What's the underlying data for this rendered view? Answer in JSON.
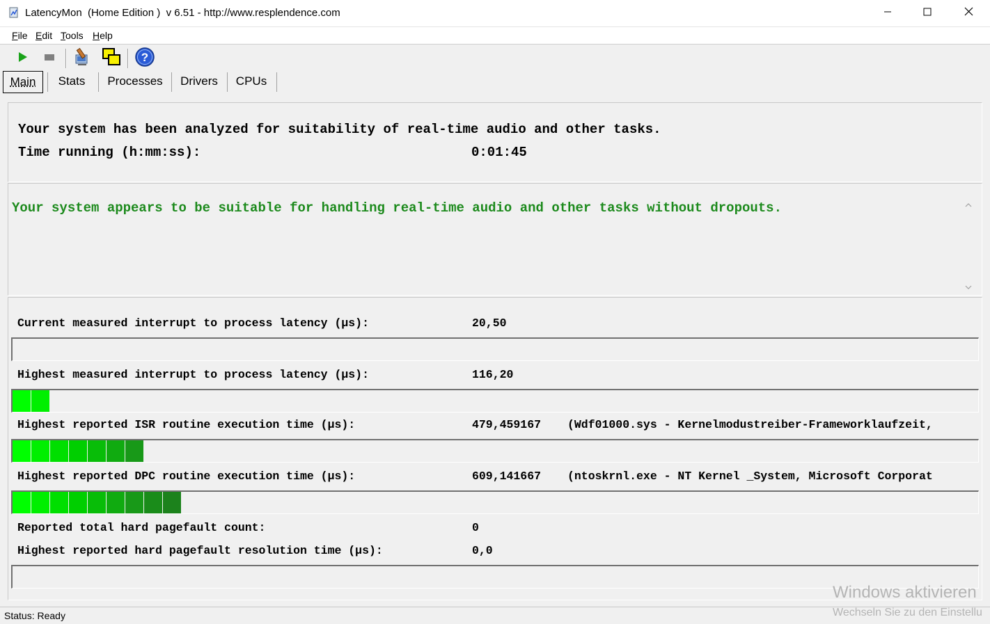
{
  "window": {
    "title": "LatencyMon  (Home Edition )  v 6.51 - http://www.resplendence.com",
    "icons": {
      "app": "latencymon-app-icon",
      "minimize": "minimize-icon",
      "maximize": "maximize-icon",
      "close": "close-icon"
    }
  },
  "menu": {
    "items": [
      {
        "accel": "F",
        "rest": "ile"
      },
      {
        "accel": "E",
        "rest": "dit"
      },
      {
        "accel": "T",
        "rest": "ools"
      },
      {
        "accel": "H",
        "rest": "elp"
      }
    ]
  },
  "toolbar": {
    "icons": [
      "play-icon",
      "stop-icon",
      "analyze-icon",
      "windows-icon",
      "help-icon"
    ],
    "colors": {
      "play": "#1aa31a",
      "stop": "#808080",
      "help": "#2a5bd7"
    }
  },
  "tabs": [
    {
      "label": "Main",
      "active": true
    },
    {
      "label": "Stats",
      "active": false
    },
    {
      "label": "Processes",
      "active": false
    },
    {
      "label": "Drivers",
      "active": false
    },
    {
      "label": "CPUs",
      "active": false
    }
  ],
  "summary": {
    "line1": "Your system has been analyzed for suitability of real-time audio and other tasks.",
    "time_label": "Time running (h:mm:ss):",
    "time_value": "0:01:45"
  },
  "verdict": {
    "text": "Your system appears to be suitable for handling real-time audio and other tasks without dropouts.",
    "color": "#1c8a1c"
  },
  "metrics": {
    "current_latency": {
      "label": "Current measured interrupt to process latency (µs):",
      "value": "20,50",
      "segments": 0
    },
    "highest_latency": {
      "label": "Highest measured interrupt to process latency (µs):",
      "value": "116,20",
      "segments": 2
    },
    "isr": {
      "label": "Highest reported ISR routine execution time (µs):",
      "value": "479,459167",
      "detail": "(Wdf01000.sys - Kernelmodustreiber-Frameworklaufzeit,",
      "segments": 7
    },
    "dpc": {
      "label": "Highest reported DPC routine execution time (µs):",
      "value": "609,141667",
      "detail": "(ntoskrnl.exe - NT Kernel _System, Microsoft Corporat",
      "segments": 9
    },
    "pagefault_count": {
      "label": "Reported total hard pagefault count:",
      "value": "0"
    },
    "pagefault_time": {
      "label": "Highest reported hard pagefault resolution time (µs):",
      "value": "0,0",
      "segments": 0
    }
  },
  "segment_colors": [
    "#00ff00",
    "#00ef00",
    "#00df00",
    "#00cf00",
    "#08bd08",
    "#10ab10",
    "#189918",
    "#1a8c1a",
    "#1c821c"
  ],
  "status": {
    "text": "Status: Ready"
  },
  "watermark": {
    "line1": "Windows aktivieren",
    "line2": "Wechseln Sie zu den Einstellu"
  }
}
